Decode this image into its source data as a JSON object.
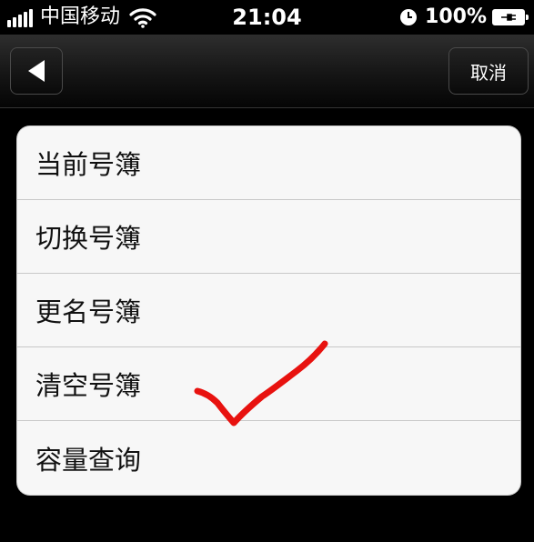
{
  "status_bar": {
    "carrier": "中国移动",
    "time": "21:04",
    "battery_percent": "100%"
  },
  "nav": {
    "back_icon": "back-arrow-icon",
    "cancel_label": "取消"
  },
  "menu": {
    "items": [
      {
        "label": "当前号簿"
      },
      {
        "label": "切换号簿"
      },
      {
        "label": "更名号簿"
      },
      {
        "label": "清空号簿"
      },
      {
        "label": "容量查询"
      }
    ]
  },
  "annotation": {
    "type": "checkmark",
    "color": "#e8120f",
    "marked_item": "清空号簿"
  }
}
